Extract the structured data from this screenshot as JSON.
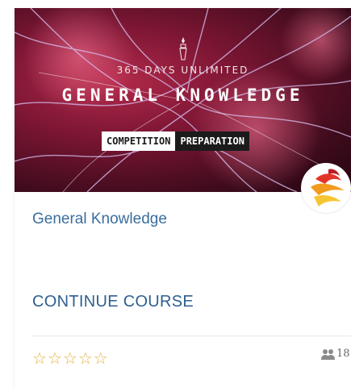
{
  "course": {
    "banner": {
      "top_text": "365 DAYS UNLIMITED",
      "main_title": "GENERAL KNOWLEDGE",
      "pill_left": "COMPETITION",
      "pill_right": "PREPARATION"
    },
    "title": "General Knowledge",
    "continue_label": "CONTINUE  COURSE",
    "rating": 0,
    "rating_max": 5,
    "students_count": "18",
    "colors": {
      "title": "#3a6e9e",
      "link": "#2f5f92",
      "star": "#e0b03c"
    },
    "icons": [
      "star-outline-icon",
      "students-icon",
      "logo-bird-icon"
    ]
  }
}
